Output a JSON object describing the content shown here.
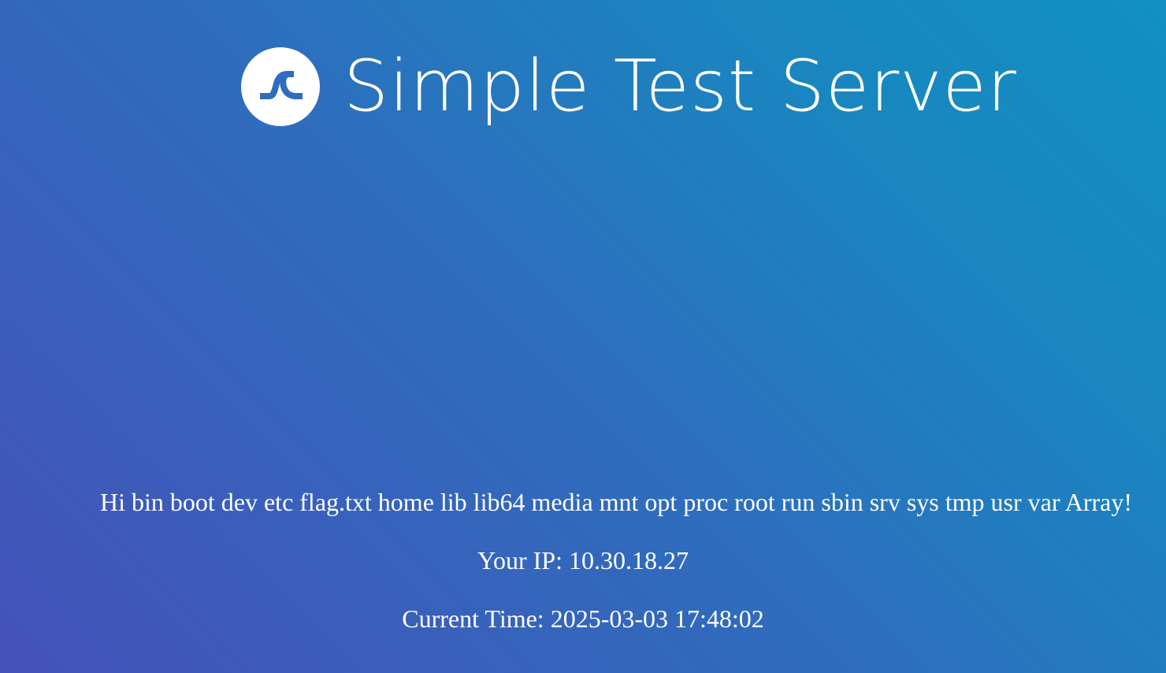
{
  "header": {
    "logo_icon": "wave-logo-icon",
    "title": "Simple Test Server"
  },
  "main": {
    "greeting": "Hi bin boot dev etc flag.txt home lib lib64 media mnt opt proc root run sbin srv sys tmp usr var Array!",
    "ip_line": "Your IP: 10.30.18.27",
    "time_line": "Current Time: 2025-03-03 17:48:02"
  },
  "colors": {
    "gradient_start": "#4651b9",
    "gradient_end": "#1290c1",
    "text": "#ffffff",
    "logo_mark": "#2f6cbd"
  }
}
